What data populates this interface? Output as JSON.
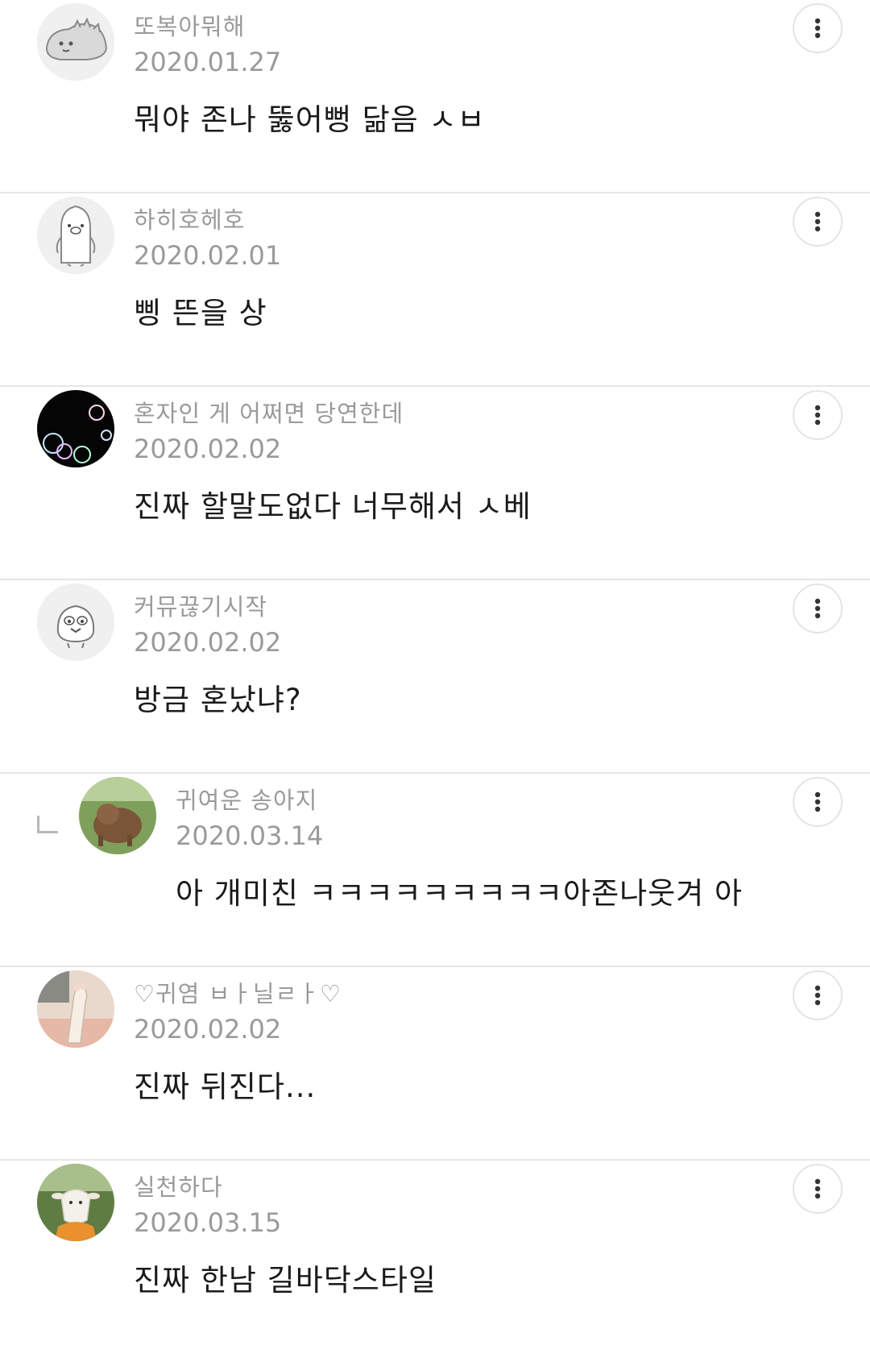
{
  "comments": [
    {
      "nickname": "또복아뭐해",
      "date": "2020.01.27",
      "text": "뭐야 존나 뚫어뻥 닮음 ㅅㅂ",
      "avatar": "dino-character-avatar",
      "reply": false
    },
    {
      "nickname": "하히호헤호",
      "date": "2020.02.01",
      "text": "삥 뜬을 상",
      "avatar": "penguin-character-avatar",
      "reply": false
    },
    {
      "nickname": "혼자인 게 어쩌면 당연한데",
      "date": "2020.02.02",
      "text": "진짜 할말도없다 너무해서 ㅅ베",
      "avatar": "bubbles-photo-avatar",
      "reply": false
    },
    {
      "nickname": "커뮤끊기시작",
      "date": "2020.02.02",
      "text": "방금 혼났냐?",
      "avatar": "chick-character-avatar",
      "reply": false
    },
    {
      "nickname": "귀여운 송아지",
      "date": "2020.03.14",
      "text": "아 개미친 ㅋㅋㅋㅋㅋㅋㅋㅋㅋ아존나웃겨 아",
      "avatar": "calf-photo-avatar",
      "reply": true
    },
    {
      "nickname": "♡귀염 ㅂㅏ닐ㄹㅏ♡",
      "date": "2020.02.02",
      "text": "진짜 뒤진다...",
      "avatar": "cat-paw-photo-avatar",
      "reply": false
    },
    {
      "nickname": "실천하다",
      "date": "2020.03.15",
      "text": "진짜 한남 길바닥스타일",
      "avatar": "lamb-photo-avatar",
      "reply": false
    }
  ],
  "icons": {
    "more": "more-vertical-icon",
    "reply": "reply-arrow-icon"
  },
  "colors": {
    "meta_text": "#9a9a9a",
    "body_text": "#1a1a1a",
    "divider": "#e6e6e6"
  }
}
